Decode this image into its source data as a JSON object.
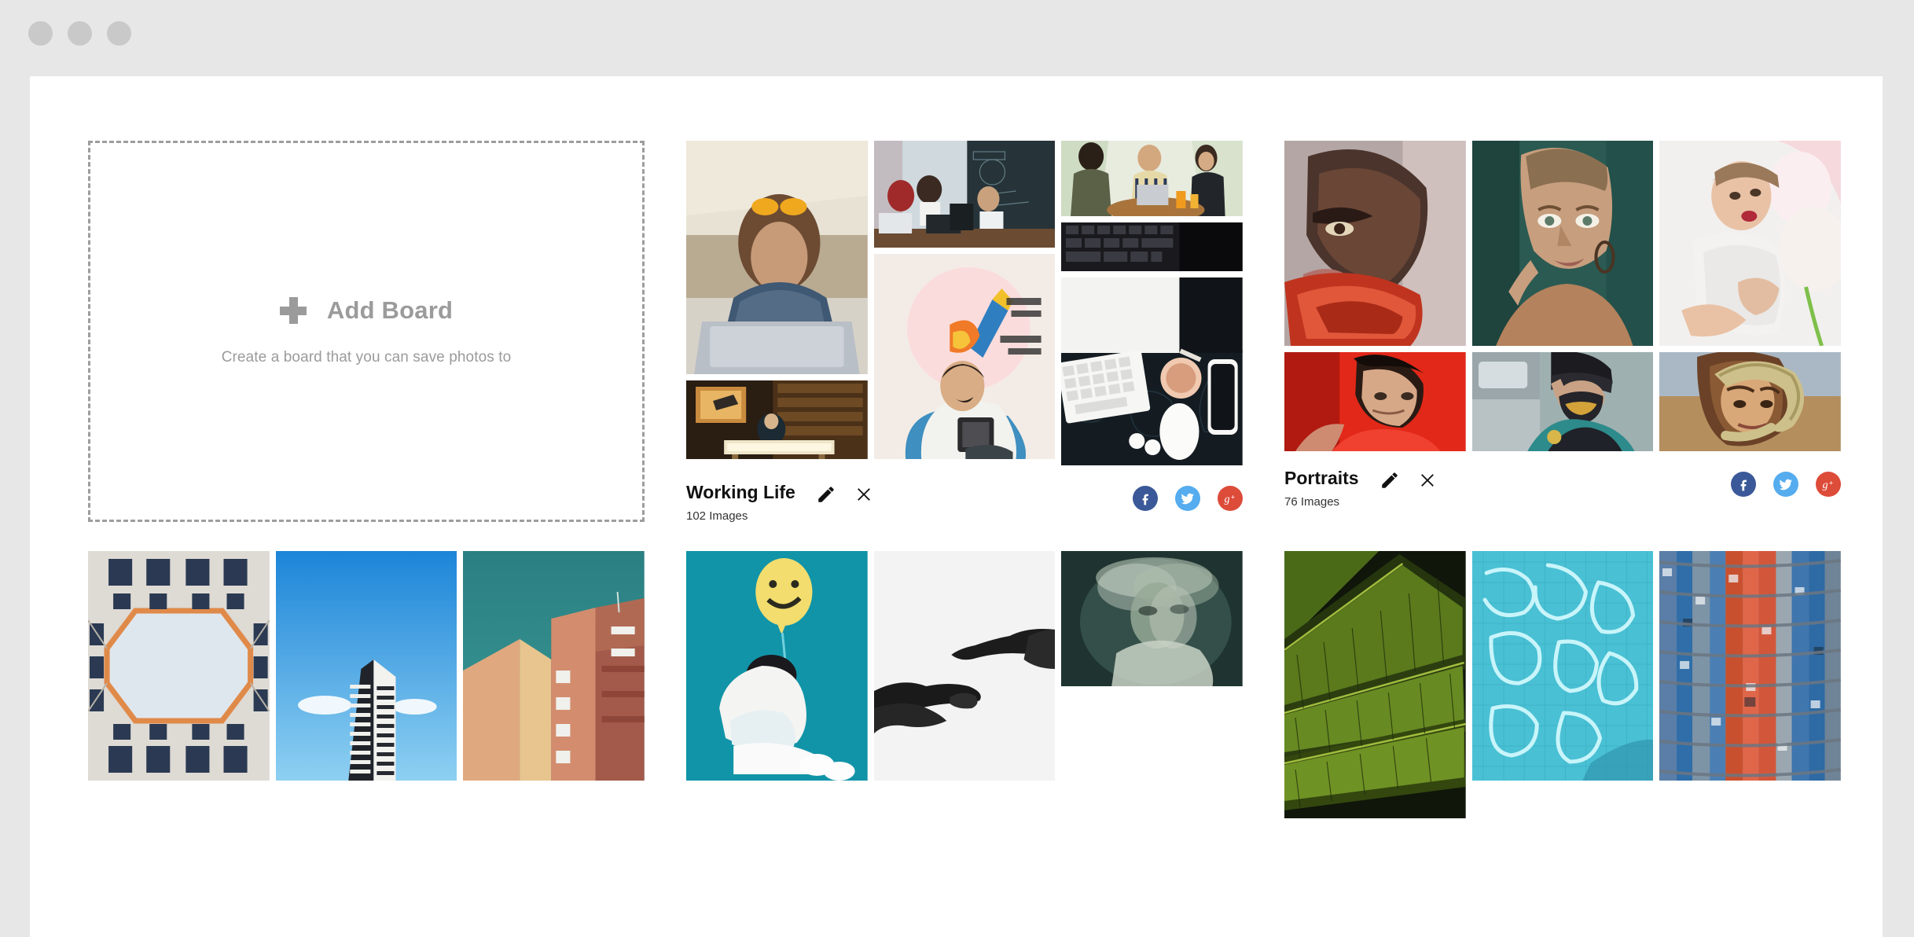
{
  "window": {
    "traffic_lights": [
      "close-dot",
      "minimize-dot",
      "maximize-dot"
    ]
  },
  "add_board": {
    "icon": "plus-icon",
    "title": "Add Board",
    "subtitle": "Create a board that you can save photos to"
  },
  "social": {
    "facebook_label": "f",
    "twitter_label": "twitter-bird",
    "googleplus_label": "g+",
    "facebook_color": "#3b5998",
    "twitter_color": "#55acee",
    "googleplus_color": "#dd4b39"
  },
  "actions": {
    "edit_label": "pencil-icon",
    "close_label": "close-icon"
  },
  "boards": [
    {
      "id": "working-life",
      "title": "Working Life",
      "count": "102 Images",
      "images": [
        {
          "name": "woman-with-laptop-in-cafe"
        },
        {
          "name": "students-at-laptops-classroom"
        },
        {
          "name": "three-colleagues-meeting-at-table"
        },
        {
          "name": "man-reading-tablet-on-beanbag"
        },
        {
          "name": "laptop-keyboard-flatlay"
        },
        {
          "name": "desk-flatlay-with-keyboard-and-coffee"
        },
        {
          "name": "person-drawing-at-lightbox-desk"
        }
      ]
    },
    {
      "id": "portraits",
      "title": "Portraits",
      "count": "76 Images",
      "images": [
        {
          "name": "portrait-woman-red-latex-collar"
        },
        {
          "name": "portrait-buzzcut-woman-tan-top"
        },
        {
          "name": "portrait-girl-with-white-flowers"
        },
        {
          "name": "portrait-young-man-red-background"
        },
        {
          "name": "portrait-person-cap-and-mask-street"
        },
        {
          "name": "portrait-curly-hair-man-with-snake"
        }
      ]
    },
    {
      "id": "architecture",
      "title": "",
      "count": "",
      "images": [
        {
          "name": "courtyard-looking-up-octagon-sky"
        },
        {
          "name": "highrise-tower-against-blue-sky"
        },
        {
          "name": "pink-modernist-building-corner"
        }
      ]
    },
    {
      "id": "emotions",
      "title": "",
      "count": "",
      "images": [
        {
          "name": "person-with-balloon-head-teal-background"
        },
        {
          "name": "two-black-hands-reaching"
        },
        {
          "name": "motion-blur-portrait-green"
        }
      ]
    },
    {
      "id": "nature-textures",
      "title": "",
      "count": "",
      "images": [
        {
          "name": "macro-green-leaf-veins"
        },
        {
          "name": "pool-water-caustics"
        },
        {
          "name": "colorful-glass-tower-facade"
        }
      ]
    }
  ]
}
